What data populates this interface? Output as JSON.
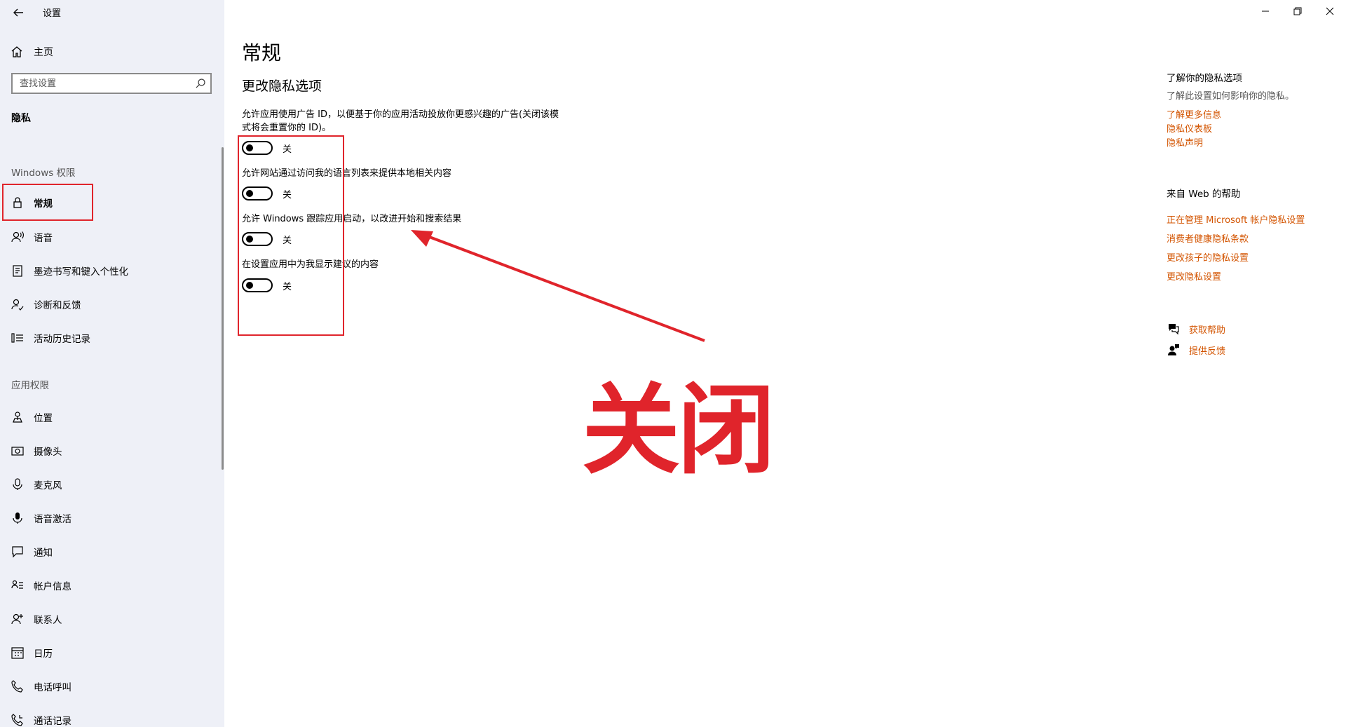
{
  "window": {
    "title": "设置",
    "controls": [
      "minimize-icon",
      "restore-icon",
      "close-icon"
    ]
  },
  "sidebar": {
    "home_label": "主页",
    "search_placeholder": "查找设置",
    "section_title": "隐私",
    "windows_group_title": "Windows 权限",
    "windows_items": [
      {
        "label": "常规",
        "icon": "lock-icon",
        "selected": true
      },
      {
        "label": "语音",
        "icon": "speech-icon"
      },
      {
        "label": "墨迹书写和键入个性化",
        "icon": "ink-icon"
      },
      {
        "label": "诊断和反馈",
        "icon": "diagnostics-icon"
      },
      {
        "label": "活动历史记录",
        "icon": "history-icon"
      }
    ],
    "app_group_title": "应用权限",
    "app_items": [
      {
        "label": "位置",
        "icon": "location-icon"
      },
      {
        "label": "摄像头",
        "icon": "camera-icon"
      },
      {
        "label": "麦克风",
        "icon": "microphone-icon"
      },
      {
        "label": "语音激活",
        "icon": "voice-activation-icon"
      },
      {
        "label": "通知",
        "icon": "notification-icon"
      },
      {
        "label": "帐户信息",
        "icon": "account-info-icon"
      },
      {
        "label": "联系人",
        "icon": "contacts-icon"
      },
      {
        "label": "日历",
        "icon": "calendar-icon"
      },
      {
        "label": "电话呼叫",
        "icon": "phone-icon"
      },
      {
        "label": "通话记录",
        "icon": "call-history-icon"
      }
    ]
  },
  "main": {
    "title": "常规",
    "subtitle": "更改隐私选项",
    "settings": [
      {
        "description": "允许应用使用广告 ID，以便基于你的应用活动投放你更感兴趣的广告(关闭该模式将会重置你的 ID)。",
        "state": "关",
        "on": false
      },
      {
        "description": "允许网站通过访问我的语言列表来提供本地相关内容",
        "state": "关",
        "on": false
      },
      {
        "description": "允许 Windows 跟踪应用启动，以改进开始和搜索结果",
        "state": "关",
        "on": false
      },
      {
        "description": "在设置应用中为我显示建议的内容",
        "state": "关",
        "on": false
      }
    ]
  },
  "annotation": {
    "text": "关闭",
    "color": "#e0242b"
  },
  "right_panel": {
    "privacy_heading": "了解你的隐私选项",
    "privacy_text": "了解此设置如何影响你的隐私。",
    "privacy_links": [
      "了解更多信息",
      "隐私仪表板",
      "隐私声明"
    ],
    "web_help_heading": "来自 Web 的帮助",
    "web_help_links": [
      "正在管理 Microsoft 帐户隐私设置",
      "消费者健康隐私条款",
      "更改孩子的隐私设置",
      "更改隐私设置"
    ],
    "get_help": "获取帮助",
    "feedback": "提供反馈",
    "link_color": "#d35400"
  }
}
